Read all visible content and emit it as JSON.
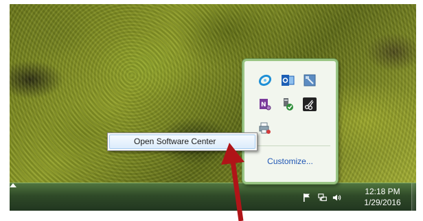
{
  "desktop": {
    "wallpaper": "moss-wallpaper"
  },
  "context_menu": {
    "items": [
      {
        "label": "Open Software Center"
      }
    ]
  },
  "notification_overflow": {
    "icons": [
      {
        "name": "sync-icon",
        "color": "#1e8fd6"
      },
      {
        "name": "outlook-icon",
        "color": "#1c5fb5"
      },
      {
        "name": "remote-desktop-icon",
        "color": "#4a7fb8"
      },
      {
        "name": "onenote-icon",
        "color": "#7a3a9b"
      },
      {
        "name": "software-center-icon",
        "color": "#2f8f3a"
      },
      {
        "name": "snipping-tool-icon",
        "color": "#222222"
      },
      {
        "name": "printer-icon",
        "color": "#6a7d8a"
      }
    ],
    "customize_label": "Customize..."
  },
  "taskbar": {
    "tray_icons": [
      "show-hidden-icons-icon",
      "action-center-flag-icon",
      "network-icon",
      "volume-icon"
    ],
    "clock": {
      "time": "12:18 PM",
      "date": "1/29/2016"
    }
  },
  "annotation": {
    "arrow_color": "#b01418"
  }
}
